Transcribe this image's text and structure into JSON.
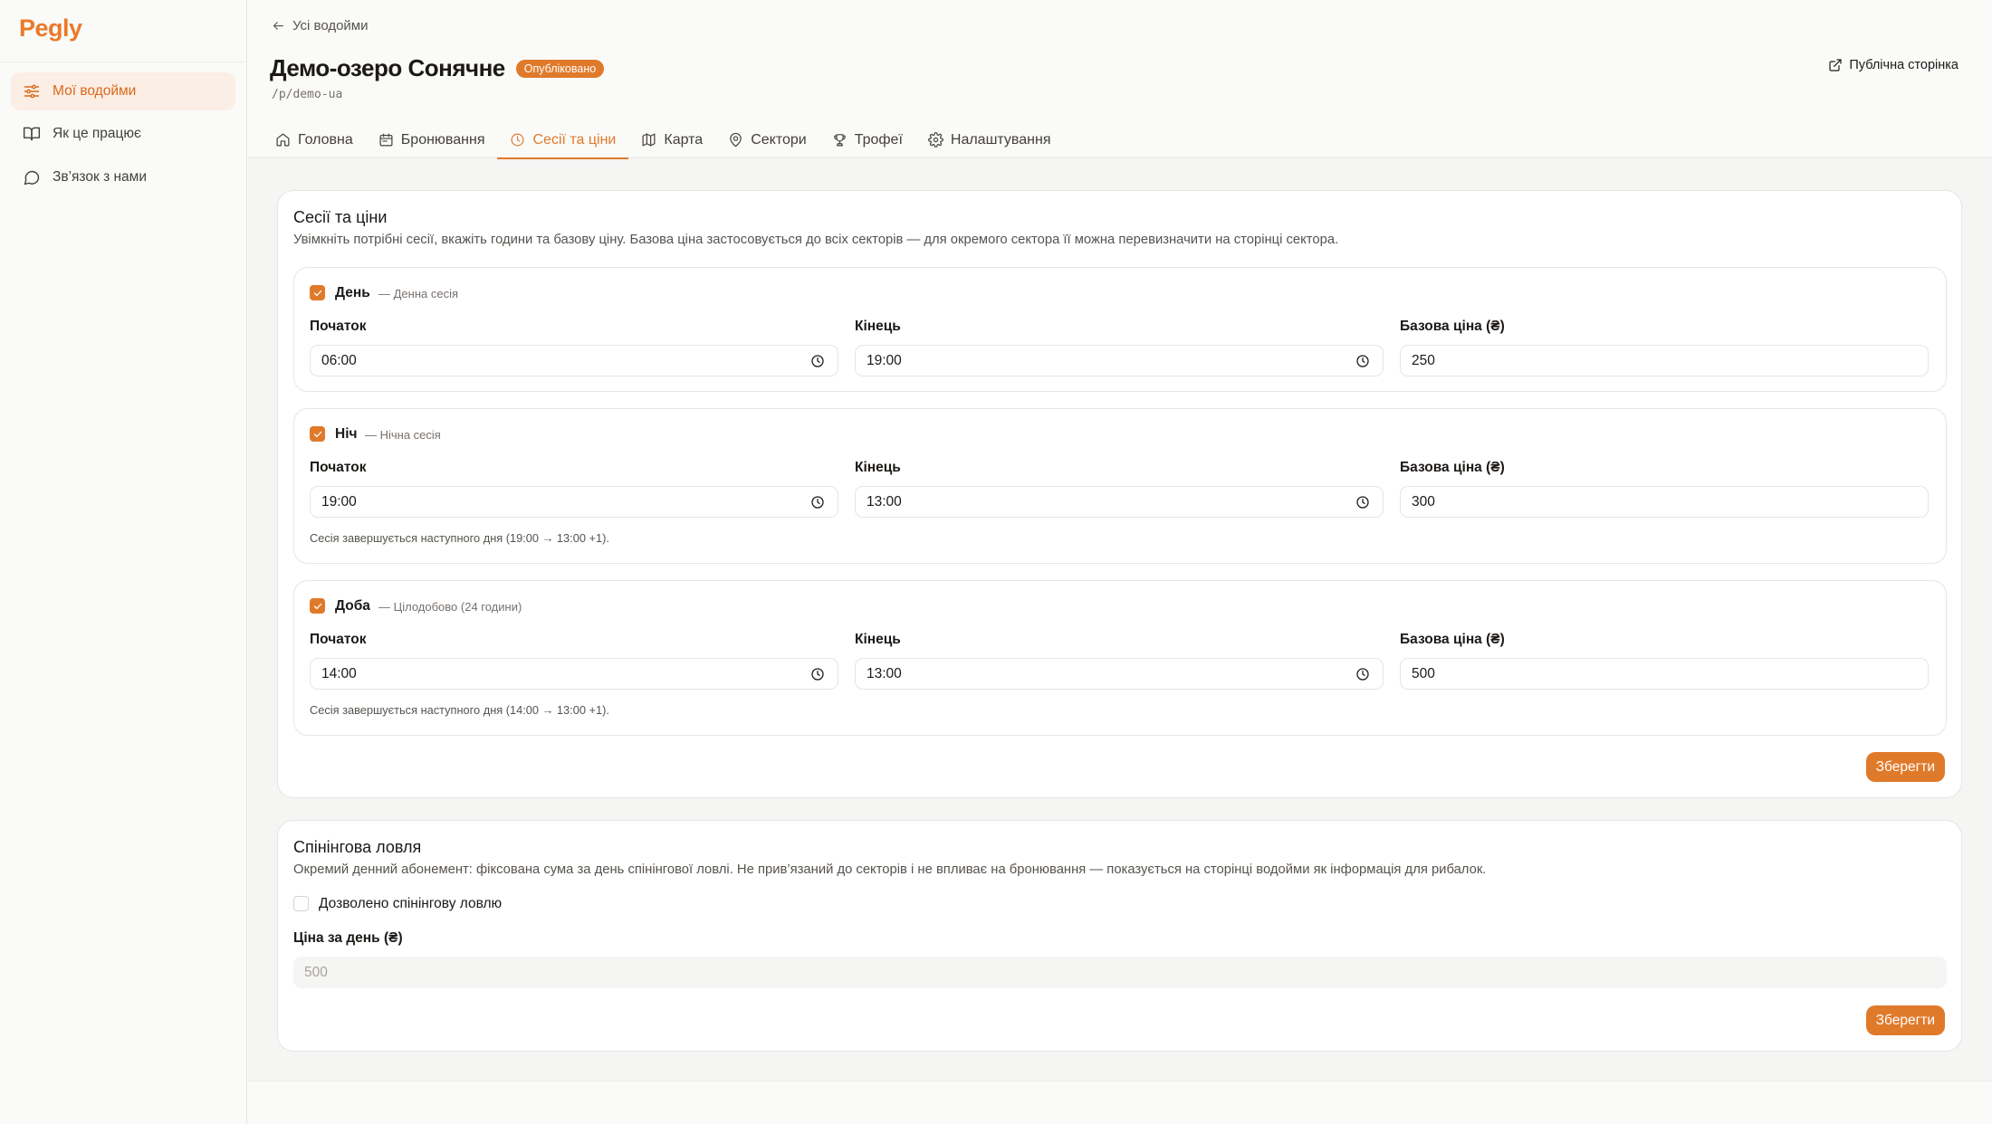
{
  "app": {
    "logo": "Pegly"
  },
  "sidebar": {
    "items": [
      {
        "label": "Мої водойми",
        "icon": "sliders-icon",
        "active": true
      },
      {
        "label": "Як це працює",
        "icon": "book-icon",
        "active": false
      },
      {
        "label": "Зв’язок з нами",
        "icon": "chat-bubble-icon",
        "active": false
      }
    ]
  },
  "header": {
    "back_label": "Усі водойми",
    "title": "Демо-озеро Сонячне",
    "status": "Опубліковано",
    "slug": "/p/demo-ua",
    "public_link": "Публічна сторінка",
    "tabs": [
      {
        "label": "Головна",
        "icon": "home-icon"
      },
      {
        "label": "Бронювання",
        "icon": "calendar-icon"
      },
      {
        "label": "Сесії та ціни",
        "icon": "clock-icon",
        "active": true
      },
      {
        "label": "Карта",
        "icon": "map-icon"
      },
      {
        "label": "Сектори",
        "icon": "map-pin-icon"
      },
      {
        "label": "Трофеї",
        "icon": "trophy-icon"
      },
      {
        "label": "Налаштування",
        "icon": "gear-icon"
      }
    ]
  },
  "sessions_card": {
    "title": "Сесії та ціни",
    "description": "Увімкніть потрібні сесії, вкажіть години та базову ціну. Базова ціна застосовується до всіх секторів — для окремого сектора її можна перевизначити на сторінці сектора.",
    "start_label": "Початок",
    "end_label": "Кінець",
    "price_label": "Базова ціна (₴)",
    "save_label": "Зберегти",
    "sessions": [
      {
        "name": "День",
        "subtitle": "— Денна сесія",
        "checked": true,
        "start": "06:00",
        "end": "19:00",
        "price": "250",
        "note": ""
      },
      {
        "name": "Ніч",
        "subtitle": "— Нічна сесія",
        "checked": true,
        "start": "19:00",
        "end": "13:00",
        "price": "300",
        "note": "Сесія завершується наступного дня (19:00 → 13:00 +1)."
      },
      {
        "name": "Доба",
        "subtitle": "— Цілодобово (24 години)",
        "checked": true,
        "start": "14:00",
        "end": "13:00",
        "price": "500",
        "note": "Сесія завершується наступного дня (14:00 → 13:00 +1)."
      }
    ]
  },
  "spinning_card": {
    "title": "Спінінгова ловля",
    "description": "Окремий денний абонемент: фіксована сума за день спінінгової ловлі. Не прив’язаний до секторів і не впливає на бронювання — показується на сторінці водойми як інформація для рибалок.",
    "checkbox_label": "Дозволено спінінгову ловлю",
    "checked": false,
    "price_label": "Ціна за день (₴)",
    "price_placeholder": "500",
    "save_label": "Зберегти"
  },
  "colors": {
    "accent": "#e07a2b",
    "active_bg": "#fbeee4"
  }
}
